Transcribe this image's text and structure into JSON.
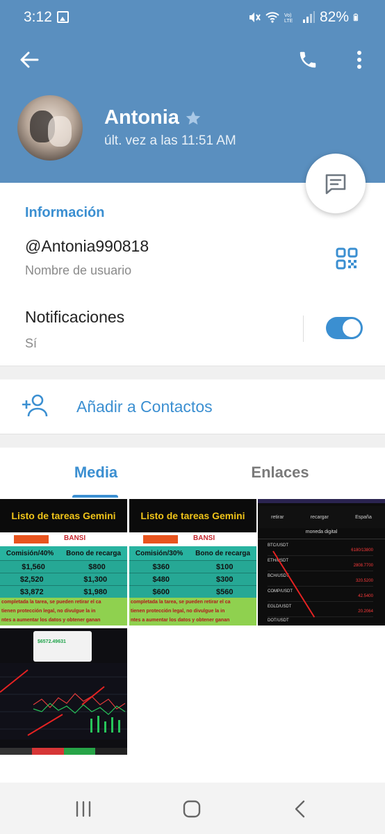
{
  "status_bar": {
    "time": "3:12",
    "battery_percent": "82%",
    "icons": [
      "image-icon",
      "mute-icon",
      "wifi-icon",
      "volte-icon",
      "signal-icon",
      "battery-icon"
    ]
  },
  "header": {
    "name": "Antonia",
    "last_seen": "últ. vez a las 11:51 AM",
    "icons": [
      "back-arrow-icon",
      "phone-icon",
      "more-vert-icon",
      "star-icon",
      "message-icon"
    ]
  },
  "info": {
    "section_title": "Información",
    "username": "@Antonia990818",
    "username_label": "Nombre de usuario",
    "notifications_title": "Notificaciones",
    "notifications_value": "Sí",
    "notifications_enabled": true
  },
  "add_contact": {
    "label": "Añadir a Contactos"
  },
  "tabs": {
    "items": [
      "Media",
      "Enlaces"
    ],
    "active": "Media"
  },
  "media": {
    "sheet": {
      "title": "Listo de tareas Gemini",
      "brand": "BANSI",
      "headers": [
        "Comisión/40%",
        "Bono de recarga"
      ],
      "headers_2": [
        "Comisión/30%",
        "Bono de recarga"
      ],
      "rows": [
        [
          "$1,560",
          "$800"
        ],
        [
          "$2,520",
          "$1,300"
        ],
        [
          "$3,872",
          "$1,980"
        ]
      ],
      "rows_2": [
        [
          "$360",
          "$100"
        ],
        [
          "$480",
          "$300"
        ],
        [
          "$600",
          "$560"
        ]
      ],
      "note_lines": [
        "completada la tarea, se pueden retirar el ca",
        "tienen protección legal, no divulgue la in",
        "ntes a aumentar los datos y obtener ganan"
      ]
    },
    "crypto": {
      "nav": [
        "retirar",
        "recargar",
        "España"
      ],
      "title": "moneda digital",
      "rows": [
        {
          "pair": "BTC/USDT",
          "value": "6180/13800"
        },
        {
          "pair": "ETH/USDT",
          "value": "2808.7700"
        },
        {
          "pair": "BCH/USDT",
          "value": "320.5200"
        },
        {
          "pair": "COMP/USDT",
          "value": "42.5400"
        },
        {
          "pair": "EGLD/USDT",
          "value": "20.2064"
        },
        {
          "pair": "DOT/USDT",
          "value": ""
        }
      ]
    },
    "trade": {
      "price": "$6572.49631"
    }
  },
  "colors": {
    "header_bg": "#5a8fbf",
    "accent": "#3b8fd1"
  }
}
